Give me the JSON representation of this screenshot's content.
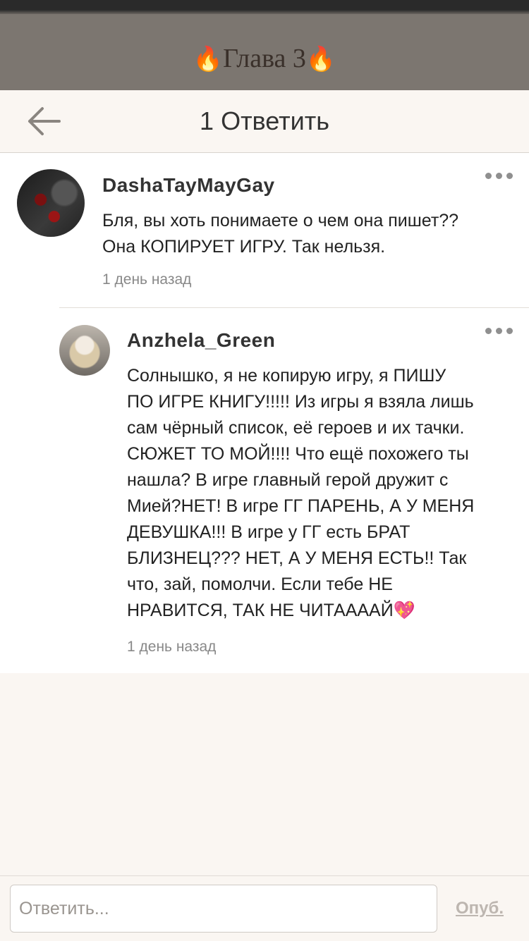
{
  "chapter": {
    "title": "Глава 3",
    "icon_left": "🔥",
    "icon_right": "🔥"
  },
  "header": {
    "title": "1 Ответить",
    "back_icon": "arrow-left-icon"
  },
  "comments": [
    {
      "author": "DashaTayMayGay",
      "text": "Бля, вы хоть понимаете о чем она пишет??\nОна КОПИРУЕТ ИГРУ. Так нельзя.",
      "time": "1 день назад"
    },
    {
      "author": "Anzhela_Green",
      "text": "Солнышко, я не копирую игру, я ПИШУ\nПО ИГРЕ КНИГУ!!!!! Из игры я взяла лишь\nсам чёрный список, её героев и их тачки.\nСЮЖЕТ ТО МОЙ!!!! Что ещё похожего ты\nнашла? В игре главный герой дружит с\nМией?НЕТ! В игре ГГ ПАРЕНЬ, А У МЕНЯ\nДЕВУШКА!!! В игре у ГГ есть БРАТ\nБЛИЗНЕЦ??? НЕТ, А У МЕНЯ ЕСТЬ!! Так\nчто, зай, помолчи. Если тебе НЕ\nНРАВИТСЯ, ТАК НЕ ЧИТААААЙ💖",
      "time": "1 день назад"
    }
  ],
  "reply": {
    "placeholder": "Ответить...",
    "publish_label": "Опуб."
  },
  "colors": {
    "chapter_bar": "#7c7670",
    "background": "#faf6f2",
    "publish_disabled": "#bdb6b0"
  }
}
